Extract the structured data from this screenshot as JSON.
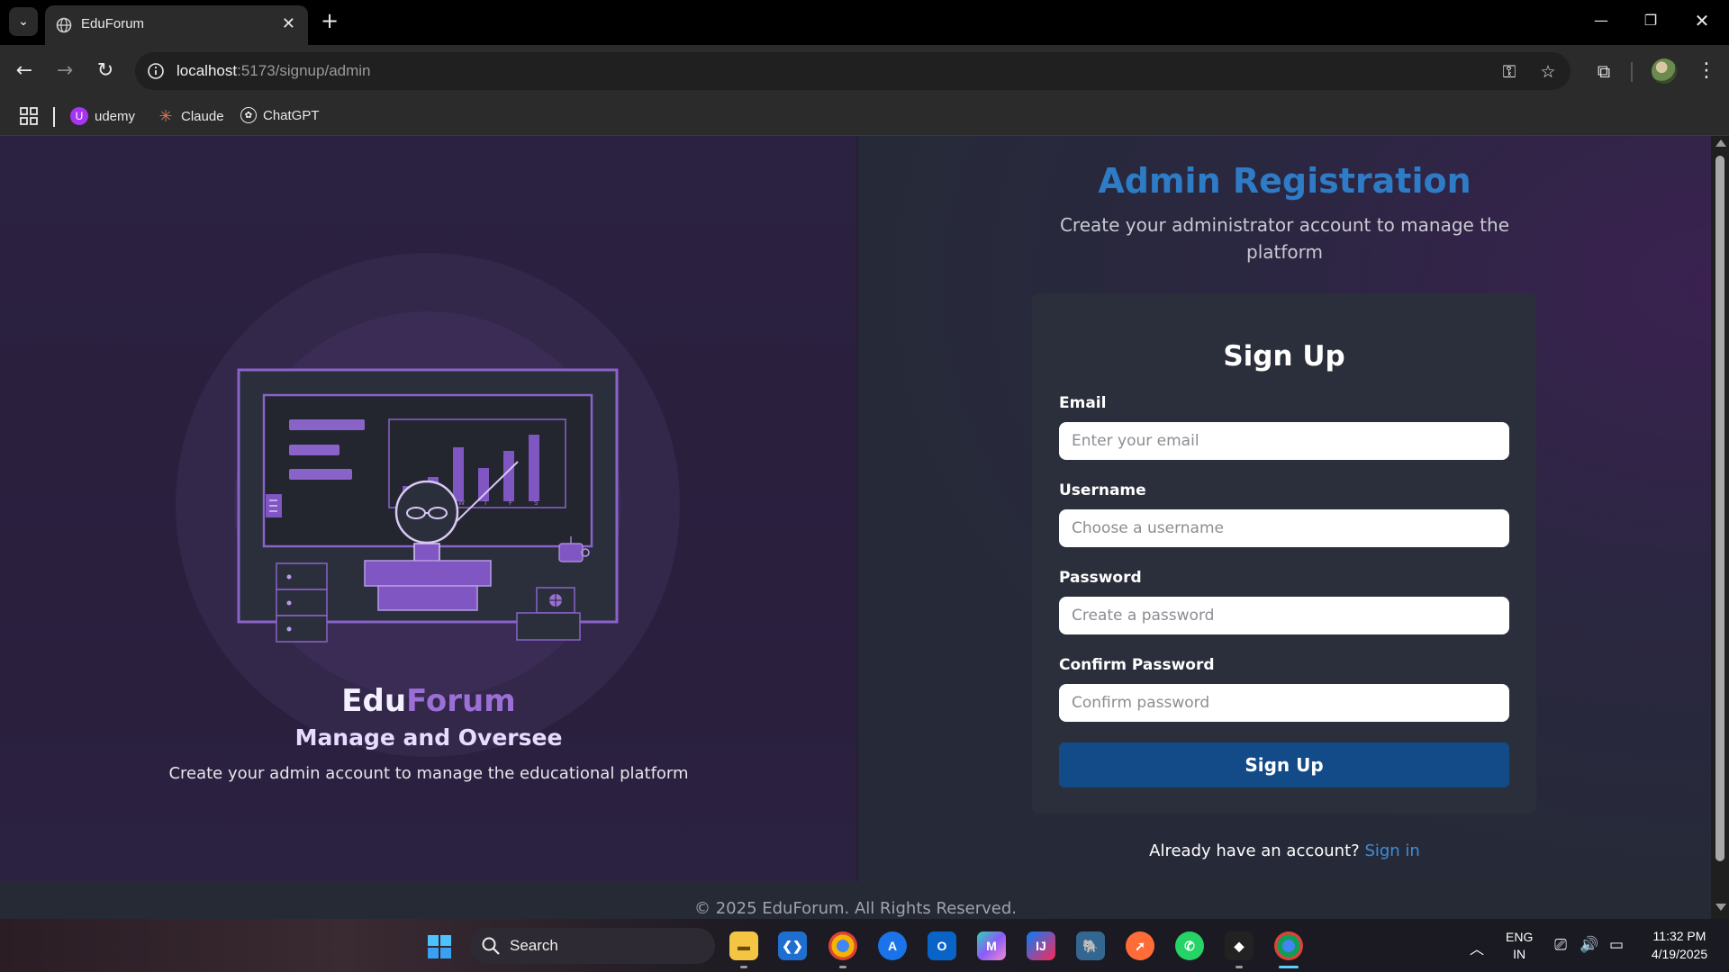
{
  "browser": {
    "tab_title": "EduForum",
    "url_host": "localhost",
    "url_path": ":5173/signup/admin",
    "bookmarks": [
      {
        "label": "udemy"
      },
      {
        "label": "Claude"
      },
      {
        "label": "ChatGPT"
      }
    ]
  },
  "left": {
    "brand_part1": "Edu",
    "brand_part2": "Forum",
    "tagline": "Manage and Oversee",
    "description": "Create your admin account to manage the educational platform",
    "illustration": {
      "chart_day_labels": [
        "W",
        "T",
        "F",
        "S"
      ]
    }
  },
  "right": {
    "title": "Admin Registration",
    "subtitle": "Create your administrator account to manage the platform",
    "form": {
      "heading": "Sign Up",
      "email_label": "Email",
      "email_placeholder": "Enter your email",
      "email_value": "",
      "username_label": "Username",
      "username_placeholder": "Choose a username",
      "username_value": "",
      "password_label": "Password",
      "password_placeholder": "Create a password",
      "password_value": "",
      "confirm_label": "Confirm Password",
      "confirm_placeholder": "Confirm password",
      "confirm_value": "",
      "submit_label": "Sign Up"
    },
    "signin_prompt": "Already have an account?",
    "signin_link": "Sign in"
  },
  "footer": {
    "text": "© 2025 EduForum. All Rights Reserved."
  },
  "taskbar": {
    "search_label": "Search",
    "lang_line1": "ENG",
    "lang_line2": "IN",
    "time": "11:32 PM",
    "date": "4/19/2025",
    "apps": [
      "file-explorer",
      "vscode",
      "chrome-canary",
      "app-store",
      "outlook",
      "copilot",
      "intellij",
      "postgres",
      "postman",
      "whatsapp",
      "unity",
      "chrome"
    ]
  },
  "colors": {
    "accent_blue": "#2e7bc6",
    "button_blue": "#124b87",
    "link_blue": "#3b8fdc",
    "brand_purple": "#9b6fd6",
    "card_bg": "#2b2f3b"
  }
}
